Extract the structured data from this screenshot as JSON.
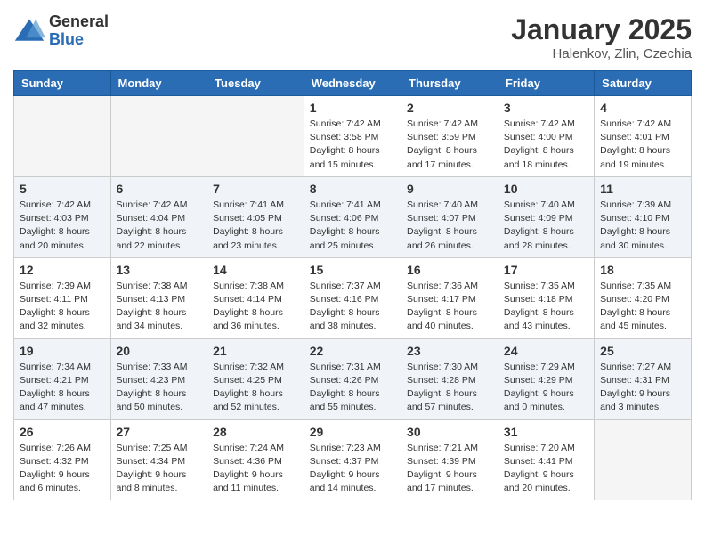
{
  "header": {
    "logo_general": "General",
    "logo_blue": "Blue",
    "month_title": "January 2025",
    "location": "Halenkov, Zlin, Czechia"
  },
  "weekdays": [
    "Sunday",
    "Monday",
    "Tuesday",
    "Wednesday",
    "Thursday",
    "Friday",
    "Saturday"
  ],
  "weeks": [
    [
      {
        "day": "",
        "info": ""
      },
      {
        "day": "",
        "info": ""
      },
      {
        "day": "",
        "info": ""
      },
      {
        "day": "1",
        "info": "Sunrise: 7:42 AM\nSunset: 3:58 PM\nDaylight: 8 hours\nand 15 minutes."
      },
      {
        "day": "2",
        "info": "Sunrise: 7:42 AM\nSunset: 3:59 PM\nDaylight: 8 hours\nand 17 minutes."
      },
      {
        "day": "3",
        "info": "Sunrise: 7:42 AM\nSunset: 4:00 PM\nDaylight: 8 hours\nand 18 minutes."
      },
      {
        "day": "4",
        "info": "Sunrise: 7:42 AM\nSunset: 4:01 PM\nDaylight: 8 hours\nand 19 minutes."
      }
    ],
    [
      {
        "day": "5",
        "info": "Sunrise: 7:42 AM\nSunset: 4:03 PM\nDaylight: 8 hours\nand 20 minutes."
      },
      {
        "day": "6",
        "info": "Sunrise: 7:42 AM\nSunset: 4:04 PM\nDaylight: 8 hours\nand 22 minutes."
      },
      {
        "day": "7",
        "info": "Sunrise: 7:41 AM\nSunset: 4:05 PM\nDaylight: 8 hours\nand 23 minutes."
      },
      {
        "day": "8",
        "info": "Sunrise: 7:41 AM\nSunset: 4:06 PM\nDaylight: 8 hours\nand 25 minutes."
      },
      {
        "day": "9",
        "info": "Sunrise: 7:40 AM\nSunset: 4:07 PM\nDaylight: 8 hours\nand 26 minutes."
      },
      {
        "day": "10",
        "info": "Sunrise: 7:40 AM\nSunset: 4:09 PM\nDaylight: 8 hours\nand 28 minutes."
      },
      {
        "day": "11",
        "info": "Sunrise: 7:39 AM\nSunset: 4:10 PM\nDaylight: 8 hours\nand 30 minutes."
      }
    ],
    [
      {
        "day": "12",
        "info": "Sunrise: 7:39 AM\nSunset: 4:11 PM\nDaylight: 8 hours\nand 32 minutes."
      },
      {
        "day": "13",
        "info": "Sunrise: 7:38 AM\nSunset: 4:13 PM\nDaylight: 8 hours\nand 34 minutes."
      },
      {
        "day": "14",
        "info": "Sunrise: 7:38 AM\nSunset: 4:14 PM\nDaylight: 8 hours\nand 36 minutes."
      },
      {
        "day": "15",
        "info": "Sunrise: 7:37 AM\nSunset: 4:16 PM\nDaylight: 8 hours\nand 38 minutes."
      },
      {
        "day": "16",
        "info": "Sunrise: 7:36 AM\nSunset: 4:17 PM\nDaylight: 8 hours\nand 40 minutes."
      },
      {
        "day": "17",
        "info": "Sunrise: 7:35 AM\nSunset: 4:18 PM\nDaylight: 8 hours\nand 43 minutes."
      },
      {
        "day": "18",
        "info": "Sunrise: 7:35 AM\nSunset: 4:20 PM\nDaylight: 8 hours\nand 45 minutes."
      }
    ],
    [
      {
        "day": "19",
        "info": "Sunrise: 7:34 AM\nSunset: 4:21 PM\nDaylight: 8 hours\nand 47 minutes."
      },
      {
        "day": "20",
        "info": "Sunrise: 7:33 AM\nSunset: 4:23 PM\nDaylight: 8 hours\nand 50 minutes."
      },
      {
        "day": "21",
        "info": "Sunrise: 7:32 AM\nSunset: 4:25 PM\nDaylight: 8 hours\nand 52 minutes."
      },
      {
        "day": "22",
        "info": "Sunrise: 7:31 AM\nSunset: 4:26 PM\nDaylight: 8 hours\nand 55 minutes."
      },
      {
        "day": "23",
        "info": "Sunrise: 7:30 AM\nSunset: 4:28 PM\nDaylight: 8 hours\nand 57 minutes."
      },
      {
        "day": "24",
        "info": "Sunrise: 7:29 AM\nSunset: 4:29 PM\nDaylight: 9 hours\nand 0 minutes."
      },
      {
        "day": "25",
        "info": "Sunrise: 7:27 AM\nSunset: 4:31 PM\nDaylight: 9 hours\nand 3 minutes."
      }
    ],
    [
      {
        "day": "26",
        "info": "Sunrise: 7:26 AM\nSunset: 4:32 PM\nDaylight: 9 hours\nand 6 minutes."
      },
      {
        "day": "27",
        "info": "Sunrise: 7:25 AM\nSunset: 4:34 PM\nDaylight: 9 hours\nand 8 minutes."
      },
      {
        "day": "28",
        "info": "Sunrise: 7:24 AM\nSunset: 4:36 PM\nDaylight: 9 hours\nand 11 minutes."
      },
      {
        "day": "29",
        "info": "Sunrise: 7:23 AM\nSunset: 4:37 PM\nDaylight: 9 hours\nand 14 minutes."
      },
      {
        "day": "30",
        "info": "Sunrise: 7:21 AM\nSunset: 4:39 PM\nDaylight: 9 hours\nand 17 minutes."
      },
      {
        "day": "31",
        "info": "Sunrise: 7:20 AM\nSunset: 4:41 PM\nDaylight: 9 hours\nand 20 minutes."
      },
      {
        "day": "",
        "info": ""
      }
    ]
  ]
}
